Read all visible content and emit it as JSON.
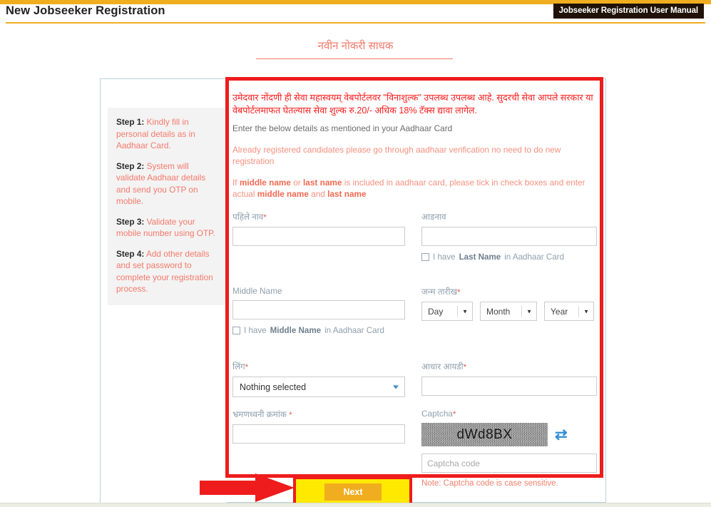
{
  "header": {
    "title": "New Jobseeker Registration",
    "manual_button": "Jobseeker Registration User Manual",
    "accent_color": "#f0ad20"
  },
  "section": {
    "heading": "नवीन नोकरी साधक",
    "heading_color": "#f4796a"
  },
  "steps": [
    {
      "label": "Step 1:",
      "text": " Kindly fill in personal details as in Aadhaar Card."
    },
    {
      "label": "Step 2:",
      "text": " System will validate Aadhaar details and send you OTP on mobile."
    },
    {
      "label": "Step 3:",
      "text": " Validate your mobile number using OTP."
    },
    {
      "label": "Step 4:",
      "text": " Add other details and set password to complete your registration process."
    }
  ],
  "notices": {
    "marathi": "उमेदवार नोंदणी ही सेवा महास्वयम् वेबपोर्टलवर \"विनाशुल्क\" उपलब्ध उपलब्ध आहे. सुदरची सेवा आपले सरकार या वेबपोर्टलमाफत घेतल्यास सेवा शुल्क रु.20/- अधिक 18% टॅक्स द्यावा लागेल.",
    "marathi_color": "#fb2020",
    "english": "Enter the below details as mentioned in your Aadhaar Card",
    "already_registered": "Already registered candidates please go through aadhaar verification no need to do new registration",
    "tick_note_a": "If ",
    "tick_note_b": "middle name",
    "tick_note_c": " or ",
    "tick_note_d": "last name",
    "tick_note_e": " is included in aadhaar card, please tick in check boxes and enter actual ",
    "tick_note_f": "middle name",
    "tick_note_g": " and ",
    "tick_note_h": "last name"
  },
  "fields": {
    "first_name": {
      "label": "पहिले नाव",
      "required": "*",
      "value": ""
    },
    "last_name": {
      "label": "आडनाव",
      "required": "",
      "value": ""
    },
    "last_name_checkbox": {
      "pre": "I have",
      "bold": "Last Name",
      "post": " in Aadhaar Card",
      "checked": false
    },
    "middle_name": {
      "label": "Middle Name",
      "required": "",
      "value": ""
    },
    "middle_name_checkbox": {
      "pre": "I have ",
      "bold": "Middle Name",
      "post": " in Aadhaar Card",
      "checked": false
    },
    "dob": {
      "label": "जन्म तारीख",
      "required": "*",
      "day": "Day",
      "month": "Month",
      "year": "Year"
    },
    "gender": {
      "label": "लिंग",
      "required": "*",
      "value": "Nothing selected"
    },
    "aadhaar": {
      "label": "आधार आयडी",
      "required": "*",
      "value": ""
    },
    "mobile": {
      "label": "भ्रमणध्वनी क्रमांक ",
      "required": "*",
      "value": ""
    },
    "captcha": {
      "label": "Captcha",
      "required": "*",
      "image_text": "dWd8BX",
      "refresh_icon": "refresh-icon",
      "input_placeholder": "Captcha code",
      "input_value": "",
      "note": "Note: Captcha code is case sensitive."
    }
  },
  "footer": {
    "next_label": "Next",
    "next_color": "#f0ad20",
    "highlight_color": "#ffe900",
    "annotation_color": "#ee1c1c"
  }
}
